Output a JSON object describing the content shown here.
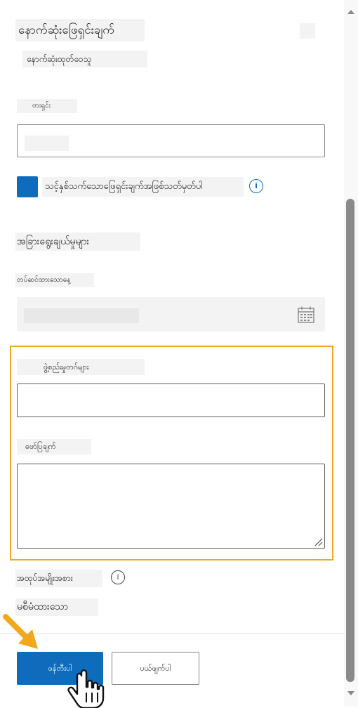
{
  "header": {
    "title": "နောက်ဆုံးဖြေရှင်းချက်",
    "pin_icon": "",
    "subtitle_icon": "",
    "subtitle": "နောက်ဆုံးထုတ်ဝေသူ"
  },
  "version": {
    "label": "ဗားရှင်း ",
    "label_icon": "",
    "value": ""
  },
  "checkbox": {
    "icon": "",
    "checked": true,
    "label": "သင့်နှစ်သက်သောဖြေရှင်းချက်အဖြစ်သတ်မှတ်ပါ",
    "info_icon": "i"
  },
  "other_options": {
    "heading": "အခြားရွေးချယ်မှုများ ",
    "heading_icon": ""
  },
  "date": {
    "label": "တပ်ဆင်ထားသောနေ့",
    "value": "    ",
    "icon": "calendar-icon"
  },
  "tags": {
    "label": "ဖွဲ့စည်းမှုတဂ်များ",
    "button_icon": ""
  },
  "description": {
    "label": "ဖော်ပြချက်",
    "value": ""
  },
  "package_type": {
    "label": "အထုပ်အမျိုးအစား",
    "info_icon": "i",
    "value": "မစီမံထားသော"
  },
  "footer": {
    "create_label": "ဖန်တီးပါ",
    "cancel_label": "ပယ်ဖျက်ပါ"
  },
  "colors": {
    "accent": "#0f6cbd",
    "highlight": "#f2a81d"
  }
}
